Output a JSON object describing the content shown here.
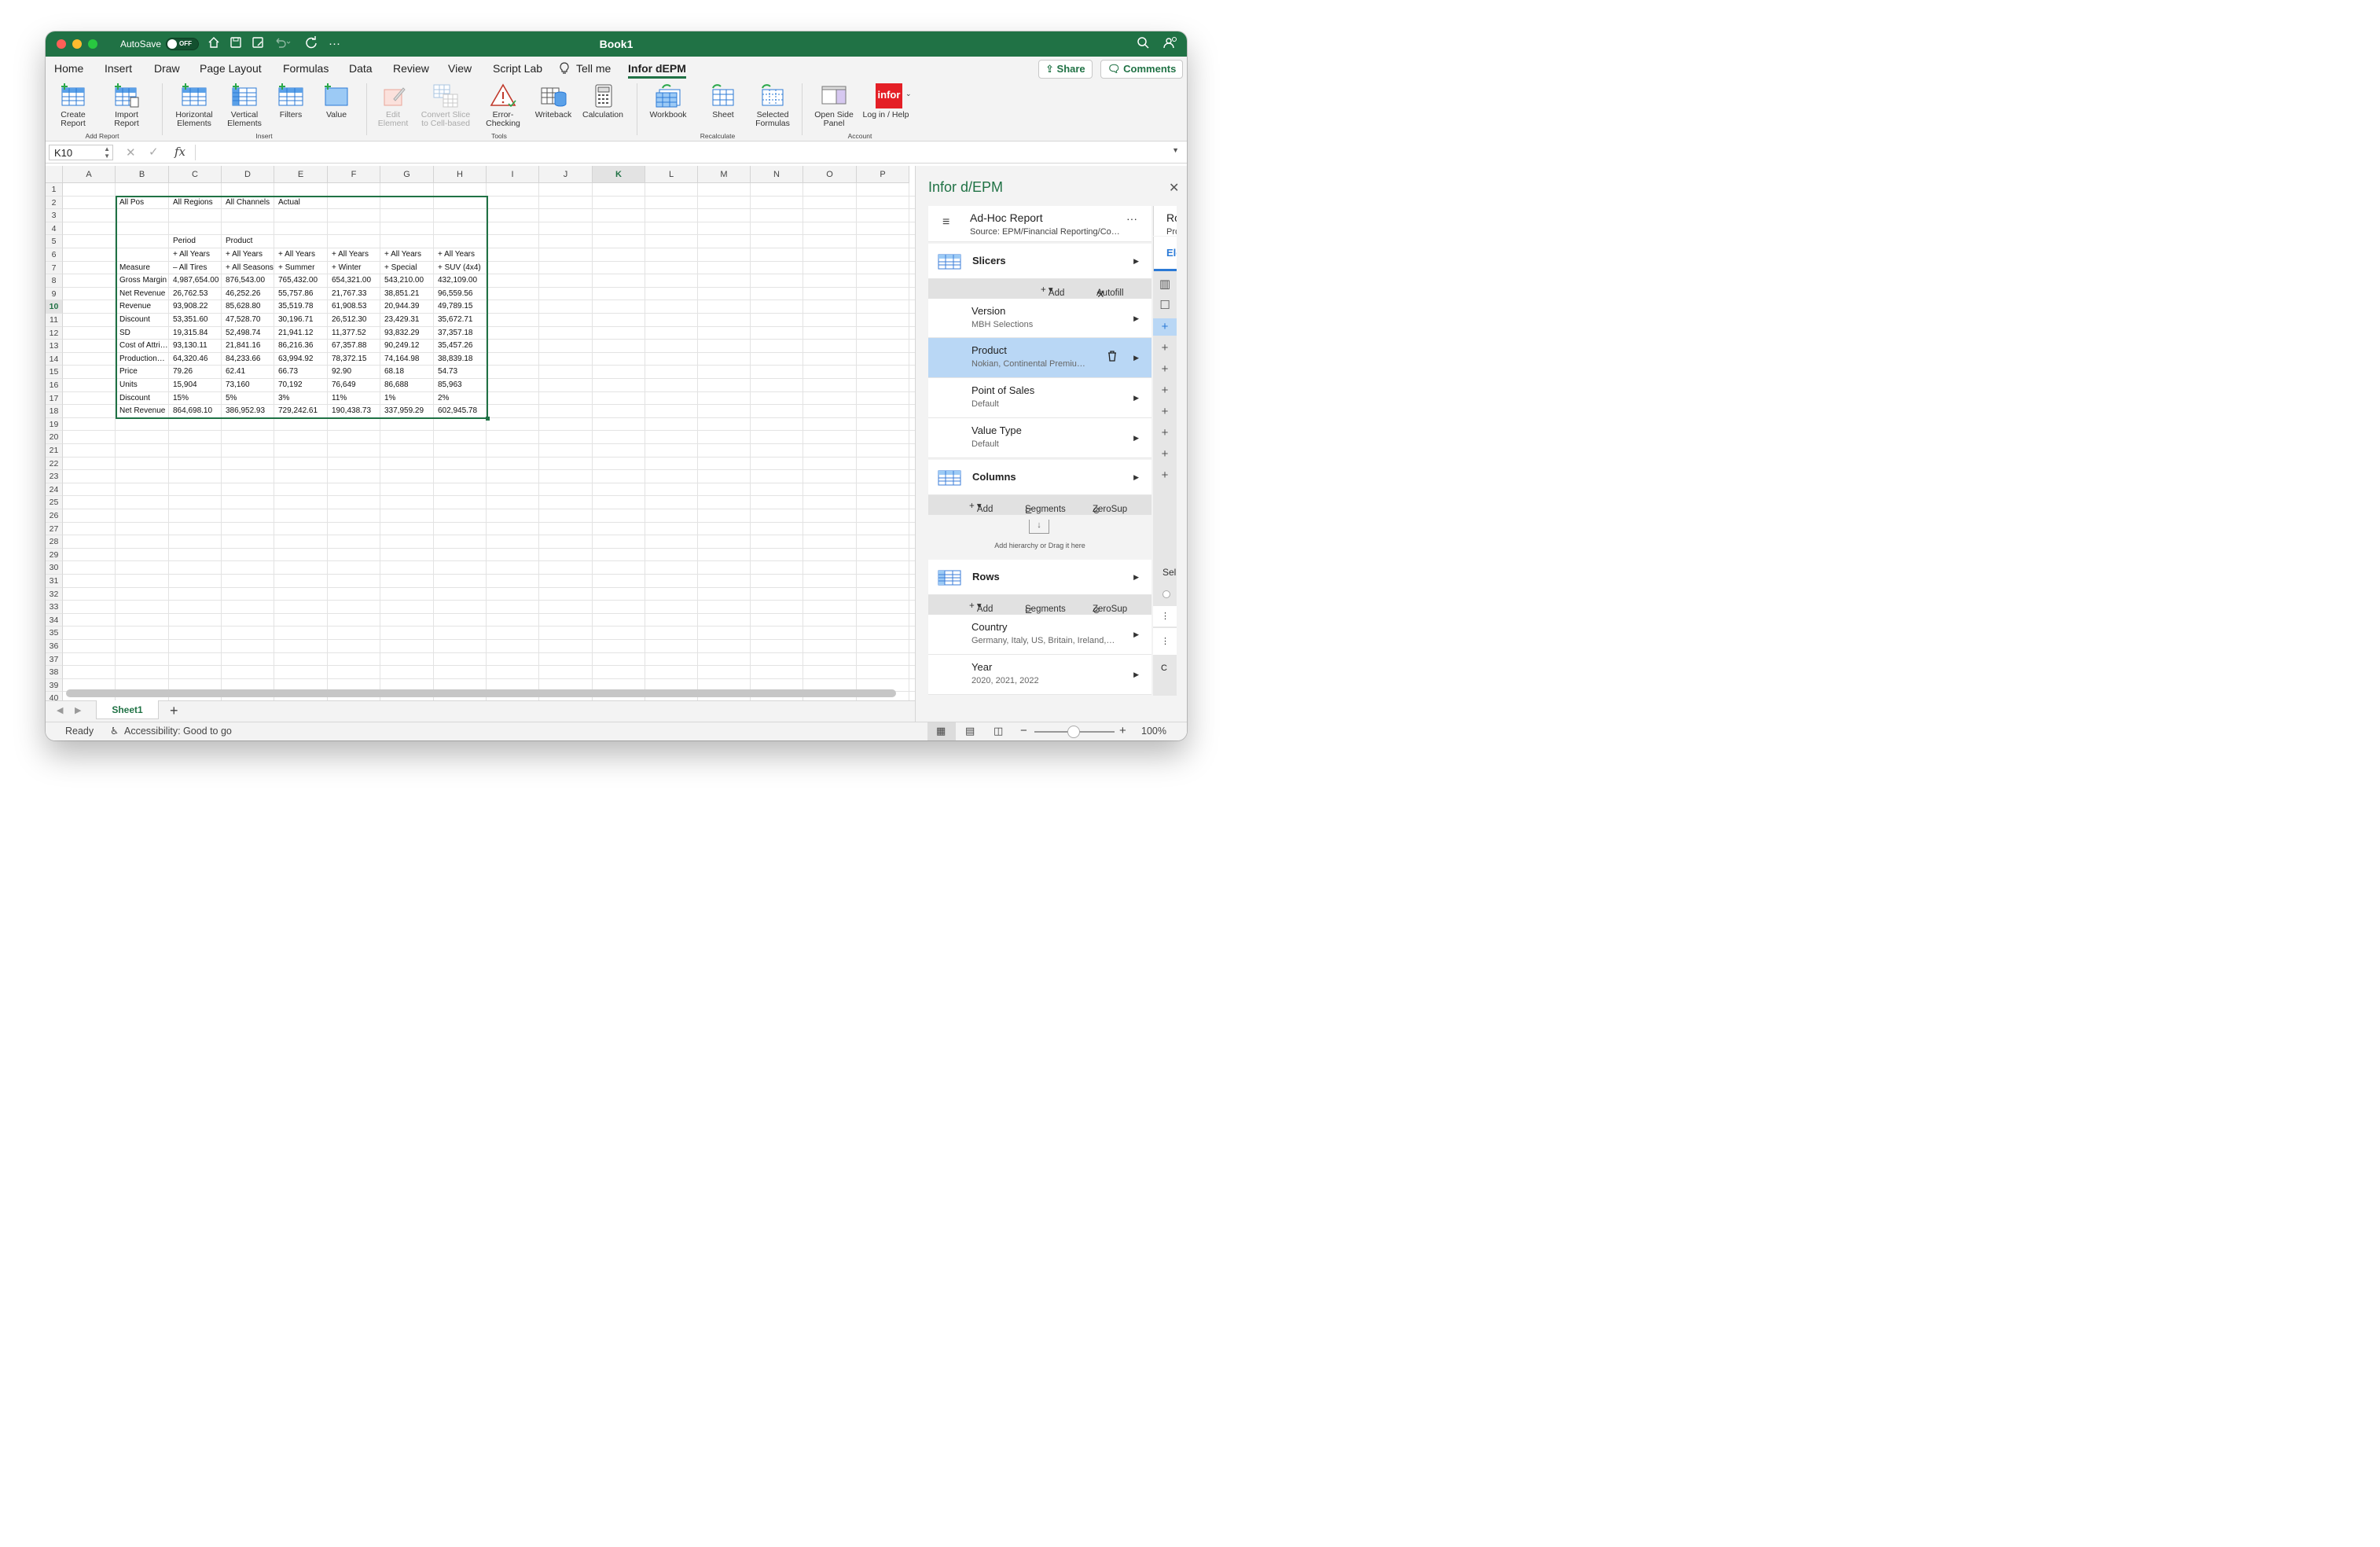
{
  "window": {
    "title": "Book1",
    "autosave_label": "AutoSave",
    "autosave_state": "OFF"
  },
  "menu": {
    "items": [
      "Home",
      "Insert",
      "Draw",
      "Page Layout",
      "Formulas",
      "Data",
      "Review",
      "View",
      "Script Lab",
      "Tell me",
      "Infor dEPM"
    ],
    "active": "Infor dEPM",
    "share": "Share",
    "comments": "Comments"
  },
  "ribbon": {
    "buttons": [
      {
        "l1": "Create",
        "l2": "Report",
        "enabled": true
      },
      {
        "l1": "Import",
        "l2": "Report",
        "enabled": true
      },
      {
        "l1": "Horizontal",
        "l2": "Elements",
        "enabled": true
      },
      {
        "l1": "Vertical",
        "l2": "Elements",
        "enabled": true
      },
      {
        "l1": "Filters",
        "l2": "",
        "enabled": true
      },
      {
        "l1": "Value",
        "l2": "",
        "enabled": true
      },
      {
        "l1": "Edit",
        "l2": "Element",
        "enabled": false
      },
      {
        "l1": "Convert Slice",
        "l2": "to Cell-based",
        "enabled": false
      },
      {
        "l1": "Error-",
        "l2": "Checking",
        "enabled": true
      },
      {
        "l1": "Writeback",
        "l2": "",
        "enabled": true
      },
      {
        "l1": "Calculation",
        "l2": "",
        "enabled": true
      },
      {
        "l1": "Workbook",
        "l2": "",
        "enabled": true
      },
      {
        "l1": "Sheet",
        "l2": "",
        "enabled": true
      },
      {
        "l1": "Selected",
        "l2": "Formulas",
        "enabled": true
      },
      {
        "l1": "Open Side",
        "l2": "Panel",
        "enabled": true
      },
      {
        "l1": "Log in / Help",
        "l2": "",
        "enabled": true
      }
    ],
    "groups": [
      "Add Report",
      "Insert",
      "Tools",
      "Recalculate",
      "Account"
    ],
    "logo_text": "infor"
  },
  "formula_bar": {
    "name_box": "K10",
    "fx": "fx",
    "value": ""
  },
  "sheet": {
    "columns": [
      "A",
      "B",
      "C",
      "D",
      "E",
      "F",
      "G",
      "H",
      "I",
      "J",
      "K",
      "L",
      "M",
      "N",
      "O",
      "P"
    ],
    "rows_count": 40,
    "cells": [
      [
        "All Pos",
        "All Regions",
        "All Channels",
        "Actual",
        "",
        "",
        ""
      ],
      [
        "",
        "",
        "",
        "",
        "",
        "",
        ""
      ],
      [
        "",
        "",
        "",
        "",
        "",
        "",
        ""
      ],
      [
        "",
        "Period",
        "Product",
        "",
        "",
        "",
        ""
      ],
      [
        "",
        "+ All Years",
        "+ All Years",
        "+ All Years",
        "+ All Years",
        "+ All Years",
        "+ All Years"
      ],
      [
        "Measure",
        "– All Tires",
        "+ All Seasons",
        "+ Summer",
        "+ Winter",
        "+ Special",
        "+ SUV (4x4)"
      ],
      [
        "Gross Margin",
        "4,987,654.00",
        "876,543.00",
        "765,432.00",
        "654,321.00",
        "543,210.00",
        "432,109.00"
      ],
      [
        "Net Revenue",
        "26,762.53",
        "46,252.26",
        "55,757.86",
        "21,767.33",
        "38,851.21",
        "96,559.56"
      ],
      [
        "Revenue",
        "93,908.22",
        "85,628.80",
        "35,519.78",
        "61,908.53",
        "20,944.39",
        "49,789.15"
      ],
      [
        "Discount",
        "53,351.60",
        "47,528.70",
        "30,196.71",
        "26,512.30",
        "23,429.31",
        "35,672.71"
      ],
      [
        "SD",
        "19,315.84",
        "52,498.74",
        "21,941.12",
        "11,377.52",
        "93,832.29",
        "37,357.18"
      ],
      [
        "Cost of Attri…",
        "93,130.11",
        "21,841.16",
        "86,216.36",
        "67,357.88",
        "90,249.12",
        "35,457.26"
      ],
      [
        "Production…",
        "64,320.46",
        "84,233.66",
        "63,994.92",
        "78,372.15",
        "74,164.98",
        "38,839.18"
      ],
      [
        "Price",
        "79.26",
        "62.41",
        "66.73",
        "92.90",
        "68.18",
        "54.73"
      ],
      [
        "Units",
        "15,904",
        "73,160",
        "70,192",
        "76,649",
        "86,688",
        "85,963"
      ],
      [
        "Discount",
        "15%",
        "5%",
        "3%",
        "11%",
        "1%",
        "2%"
      ],
      [
        "Net Revenue",
        "864,698.10",
        "386,952.93",
        "729,242.61",
        "190,438.73",
        "337,959.29",
        "602,945.78"
      ]
    ],
    "tab": "Sheet1"
  },
  "status": {
    "ready": "Ready",
    "accessibility": "Accessibility: Good to go",
    "zoom": "100%"
  },
  "pane": {
    "title": "Infor d/EPM",
    "report_title": "Ad-Hoc Report",
    "report_source": "Source: EPM/Financial Reporting/Co…",
    "peek_top": "Ro",
    "peek_sub": "Pro",
    "peek_tab": "Ele",
    "peek_sel": "Sel",
    "slicers": {
      "label": "Slicers",
      "add": "Add",
      "autofill": "Autofill",
      "items": [
        {
          "name": "Version",
          "value": "MBH Selections"
        },
        {
          "name": "Product",
          "value": "Nokian, Continental Premiu…"
        },
        {
          "name": "Point of Sales",
          "value": "Default"
        },
        {
          "name": "Value Type",
          "value": "Default"
        }
      ]
    },
    "columns": {
      "label": "Columns",
      "add": "Add",
      "segments": "Segments",
      "zerosup": "ZeroSup",
      "drop_hint": "Add hierarchy or Drag it here"
    },
    "rows": {
      "label": "Rows",
      "add": "Add",
      "segments": "Segments",
      "zerosup": "ZeroSup",
      "items": [
        {
          "name": "Country",
          "value": "Germany, Italy, US, Britain, Ireland,…"
        },
        {
          "name": "Year",
          "value": "2020, 2021, 2022"
        }
      ]
    }
  },
  "colors": {
    "accent": "#207245",
    "selected_row": "#b9d7f5",
    "logo_red": "#e41f26"
  }
}
